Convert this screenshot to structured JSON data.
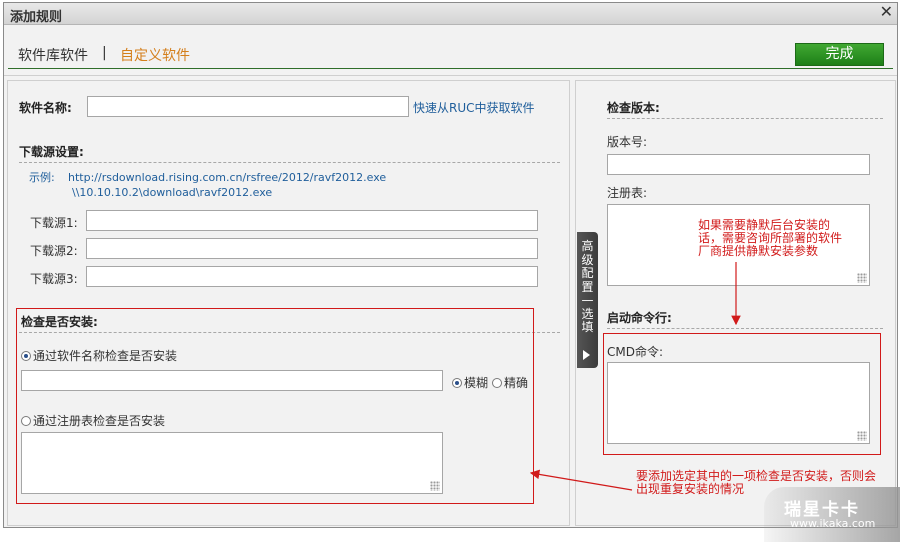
{
  "window": {
    "title": "添加规则",
    "close_glyph": "✕"
  },
  "tabs": {
    "library": "软件库软件",
    "separator": "|",
    "custom": "自定义软件"
  },
  "actions": {
    "done": "完成"
  },
  "software": {
    "name_label": "软件名称:",
    "name_value": "",
    "quick_fetch_link": "快速从RUC中获取软件"
  },
  "download": {
    "heading": "下载源设置:",
    "example_label": "示例:",
    "example_line1": "http://rsdownload.rising.com.cn/rsfree/2012/ravf2012.exe",
    "example_line2": "\\\\10.10.10.2\\download\\ravf2012.exe",
    "sources": [
      {
        "label": "下载源1:",
        "value": ""
      },
      {
        "label": "下载源2:",
        "value": ""
      },
      {
        "label": "下载源3:",
        "value": ""
      }
    ]
  },
  "install_check": {
    "heading": "检查是否安装:",
    "by_name": "通过软件名称检查是否安装",
    "match_fuzzy": "模糊",
    "match_exact": "精确",
    "by_registry": "通过注册表检查是否安装"
  },
  "advanced_tab": {
    "label": "高级配置—选填"
  },
  "version": {
    "heading": "检查版本:",
    "number_label": "版本号:",
    "registry_label": "注册表:"
  },
  "startup": {
    "heading": "启动命令行:",
    "cmd_label": "CMD命令:"
  },
  "annotations": {
    "top_note": "如果需要静默后台安装的话，需要咨询所部署的软件厂商提供静默安装参数",
    "bottom_note": "要添加选定其中的一项检查是否安装，否则会出现重复安装的情况",
    "color": "#d11a1a"
  },
  "watermark": {
    "brand": "瑞星卡卡",
    "url": "www.ikaka.com"
  },
  "colors": {
    "accent_green": "#2a8f22",
    "link_blue": "#1f5e9b",
    "tab_orange": "#d47f1c"
  }
}
